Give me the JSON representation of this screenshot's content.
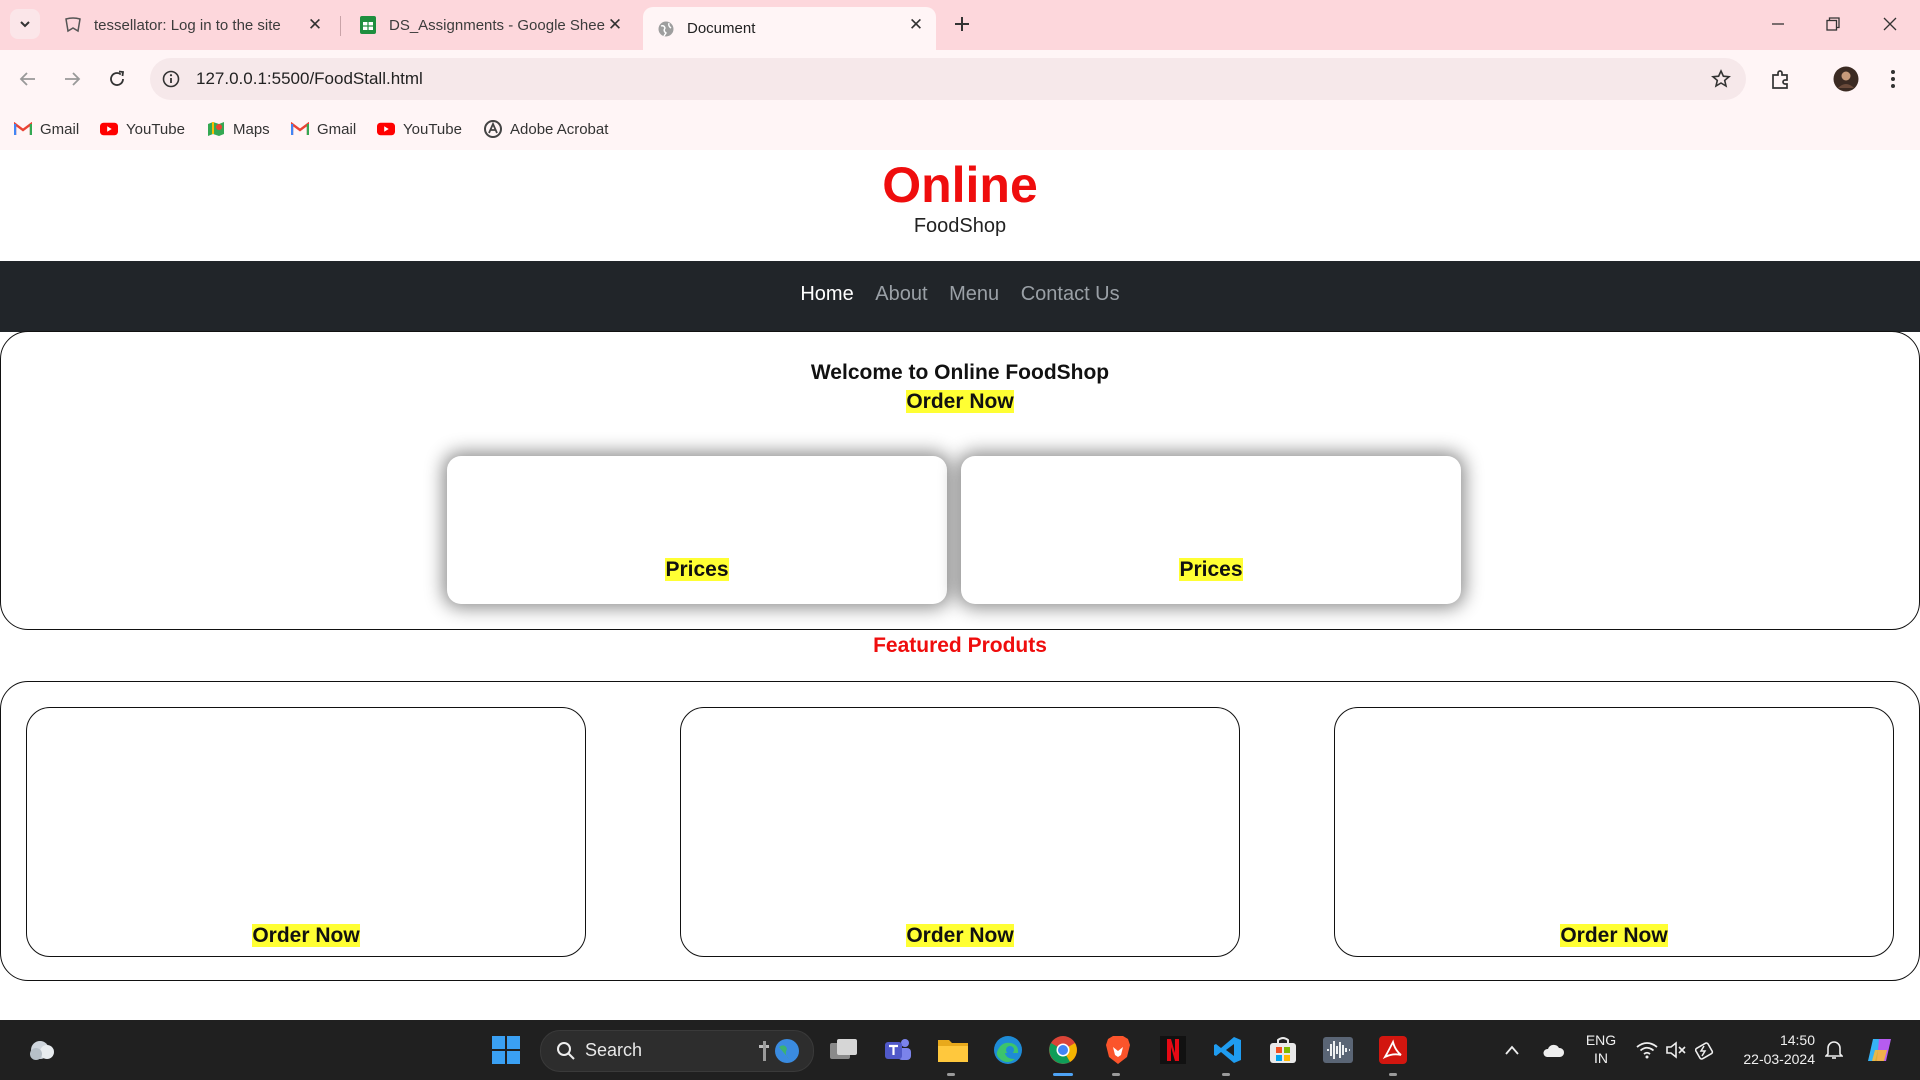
{
  "browser": {
    "tabs": [
      {
        "title": "tessellator: Log in to the site",
        "icon": "tessellator-icon"
      },
      {
        "title": "DS_Assignments - Google Shee",
        "icon": "google-sheets-icon"
      },
      {
        "title": "Document",
        "icon": "globe-icon",
        "active": true
      }
    ],
    "url": "127.0.0.1:5500/FoodStall.html",
    "bookmarks": [
      {
        "label": "Gmail",
        "icon": "gmail-icon"
      },
      {
        "label": "YouTube",
        "icon": "youtube-icon"
      },
      {
        "label": "Maps",
        "icon": "maps-icon"
      },
      {
        "label": "Gmail",
        "icon": "gmail-icon"
      },
      {
        "label": "YouTube",
        "icon": "youtube-icon"
      },
      {
        "label": "Adobe Acrobat",
        "icon": "adobe-acrobat-icon"
      }
    ]
  },
  "site": {
    "brand_title": "Online",
    "brand_subtitle": "FoodShop",
    "nav": [
      "Home",
      "About",
      "Menu",
      "Contact Us"
    ],
    "hero": {
      "welcome": "Welcome to Online FoodShop",
      "order_now": "Order Now",
      "cards": [
        "Prices",
        "Prices"
      ]
    },
    "featured": {
      "title": "Featured Produts",
      "cards": [
        "Order Now",
        "Order Now",
        "Order Now"
      ]
    }
  },
  "colors": {
    "brand_red": "#ef0d0d",
    "highlight_yellow": "#ffff33",
    "navbar_bg": "#212529",
    "tabstrip_bg": "#fdd7dc"
  },
  "taskbar": {
    "search_label": "Search",
    "lang_line1": "ENG",
    "lang_line2": "IN",
    "time": "14:50",
    "date": "22-03-2024"
  }
}
